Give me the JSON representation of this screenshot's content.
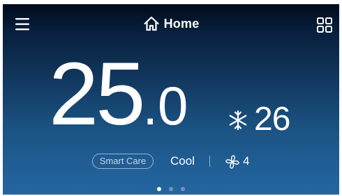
{
  "header": {
    "title": "Home",
    "menu_icon": "hamburger-menu-icon",
    "home_icon": "home-icon",
    "grid_icon": "grid-view-icon"
  },
  "current_temperature": {
    "integer_part": "25",
    "decimal_part": ".0"
  },
  "setpoint": {
    "mode_icon": "snowflake-icon",
    "value": "26"
  },
  "status": {
    "smart_care_label": "Smart Care",
    "mode": "Cool",
    "fan_icon": "fan-icon",
    "fan_speed": "4"
  },
  "pager": {
    "total": 3,
    "active_index": 0
  },
  "colors": {
    "background_top": "#000a1c",
    "background_bottom": "#2466a1",
    "text": "#ffffff",
    "inactive_dot": "#6f94bd"
  }
}
